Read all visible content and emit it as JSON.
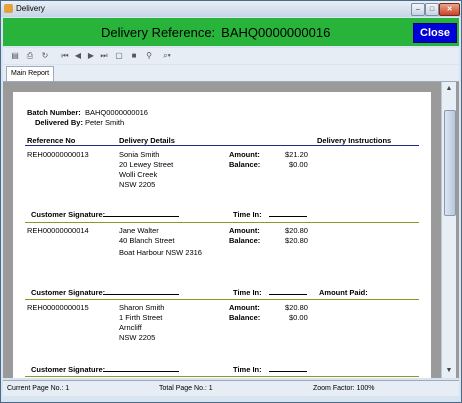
{
  "window": {
    "title": "Delivery"
  },
  "header": {
    "label": "Delivery Reference:",
    "value": "BAHQ0000000016",
    "close_label": "Close"
  },
  "toolbar": {
    "icons": [
      "export-icon",
      "print-icon",
      "refresh-icon",
      "first-page-icon",
      "prev-page-icon",
      "next-page-icon",
      "last-page-icon",
      "goto-page-icon",
      "stop-icon",
      "search-icon",
      "zoom-icon"
    ]
  },
  "tab": {
    "label": "Main Report"
  },
  "report": {
    "batch_label": "Batch Number:",
    "batch_value": "BAHQ0000000016",
    "delivered_label": "Delivered By:",
    "delivered_value": "Peter Smith",
    "col_ref": "Reference No",
    "col_details": "Delivery Details",
    "col_instr": "Delivery Instructions",
    "amount_label": "Amount:",
    "balance_label": "Balance:",
    "sig_label": "Customer Signature:",
    "time_label": "Time In:",
    "amount_paid_label": "Amount Paid:",
    "records": [
      {
        "ref": "REH00000000013",
        "name": "Sonia Smith",
        "addr1": "20 Lewey Street",
        "addr2": "Wolli Creek",
        "addr3": "NSW 2205",
        "amount": "$21.20",
        "balance": "$0.00"
      },
      {
        "ref": "REH00000000014",
        "name": "Jane Walter",
        "addr1": "40 Blanch Street",
        "addr2": "Boat Harbour NSW 2316",
        "addr3": "",
        "amount": "$20.80",
        "balance": "$20.80"
      },
      {
        "ref": "REH00000000015",
        "name": "Sharon Smith",
        "addr1": "1 Firth Street",
        "addr2": "Arncliff",
        "addr3": "NSW 2205",
        "amount": "$20.80",
        "balance": "$0.00"
      }
    ]
  },
  "status": {
    "current": "Current Page No.: 1",
    "total": "Total Page No.: 1",
    "zoom": "Zoom Factor: 100%"
  }
}
